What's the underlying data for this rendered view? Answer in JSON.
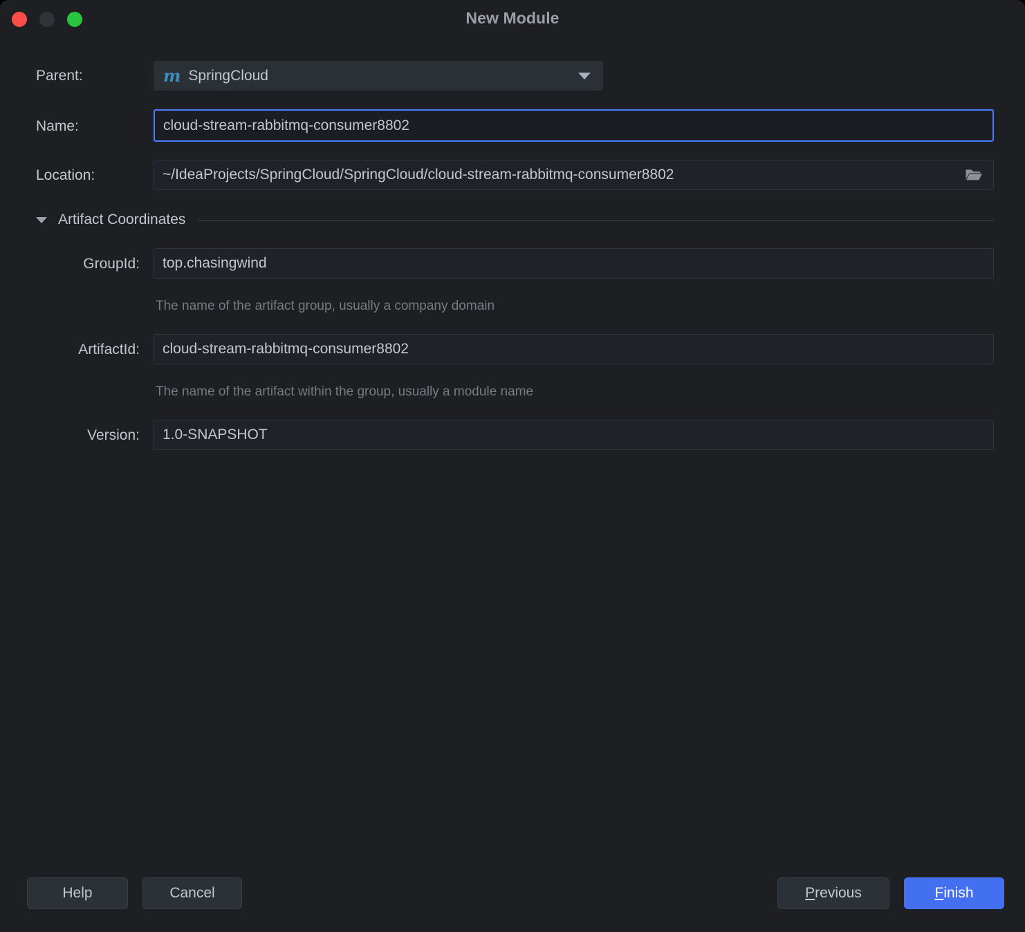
{
  "window": {
    "title": "New Module",
    "traffic_lights": [
      {
        "name": "close",
        "color": "#ff4d4a"
      },
      {
        "name": "minimize",
        "color": "#2f343b"
      },
      {
        "name": "zoom",
        "color": "#28c63e"
      }
    ],
    "background": "#1d1f23"
  },
  "form": {
    "parent": {
      "label": "Parent:",
      "icon": "maven-m-icon",
      "icon_glyph": "m",
      "icon_color": "#3a8fc0",
      "value": "SpringCloud",
      "dropdown_icon": "chevron-down-icon"
    },
    "name": {
      "label": "Name:",
      "value": "cloud-stream-rabbitmq-consumer8802",
      "placeholder": "",
      "focused": true,
      "focus_color": "#4a7dfc"
    },
    "location": {
      "label": "Location:",
      "value": "~/IdeaProjects/SpringCloud/SpringCloud/cloud-stream-rabbitmq-consumer8802",
      "placeholder": "",
      "browse_icon": "folder-open-icon"
    },
    "artifact_coordinates": {
      "label": "Artifact Coordinates",
      "expanded": true,
      "toggle_icon": "triangle-down-icon",
      "group_id": {
        "label": "GroupId:",
        "value": "top.chasingwind",
        "hint": "The name of the artifact group, usually a company domain"
      },
      "artifact_id": {
        "label": "ArtifactId:",
        "value": "cloud-stream-rabbitmq-consumer8802",
        "hint": "The name of the artifact within the group, usually a module name"
      },
      "version": {
        "label": "Version:",
        "value": "1.0-SNAPSHOT",
        "hint": ""
      }
    }
  },
  "buttons": {
    "help": {
      "label": "Help"
    },
    "cancel": {
      "label": "Cancel"
    },
    "previous": {
      "label": "Previous",
      "mnemonic": "P",
      "rest": "revious"
    },
    "finish": {
      "label": "Finish",
      "mnemonic": "F",
      "rest": "inish",
      "primary": true,
      "color": "#4270f0"
    }
  }
}
